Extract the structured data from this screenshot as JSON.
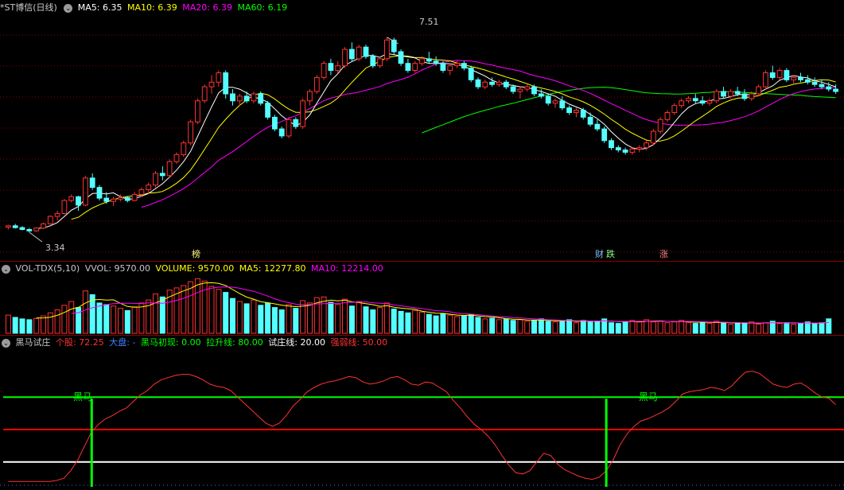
{
  "kline_legend": {
    "title": "*ST博信(日线)",
    "ma5": "MA5: 6.35",
    "ma10": "MA10: 6.39",
    "ma20": "MA20: 6.39",
    "ma60": "MA60: 6.19"
  },
  "kline_marks": {
    "high": "7.51",
    "low": "3.34",
    "bang": "榜",
    "cai": "财",
    "die": "跌",
    "zhang": "涨"
  },
  "vol_legend": {
    "name": "VOL-TDX(5,10)",
    "vvol": "VVOL: 9570.00",
    "volume": "VOLUME: 9570.00",
    "ma5": "MA5: 12277.80",
    "ma10": "MA10: 12214.00"
  },
  "ind_legend": {
    "name": "黑马试庄",
    "gegu": "个股: 72.25",
    "dapan": "大盘: -",
    "heima": "黑马初现: 0.00",
    "lasheng": "拉升线: 80.00",
    "shizhuang": "试庄线: 20.00",
    "qiangruo": "强弱线: 50.00"
  },
  "ind_annotations": [
    "黑马",
    "黑马"
  ],
  "colors": {
    "up": "#ff3232",
    "down": "#54ffff",
    "ma5": "#ffffff",
    "ma10": "#ffff00",
    "ma20": "#ff00ff",
    "ma60": "#00ff00",
    "separator": "#8b0000",
    "lasheng_line": "#00ff00",
    "qiangruo_line": "#ff0000",
    "shizhuang_line": "#ffffff"
  },
  "chart_data": [
    {
      "type": "candlestick",
      "title": "*ST博信(日线)",
      "ylim": [
        3.0,
        8.0
      ],
      "candles": [
        [
          3.45,
          3.5,
          3.4,
          3.48
        ],
        [
          3.48,
          3.52,
          3.42,
          3.44
        ],
        [
          3.44,
          3.47,
          3.38,
          3.4
        ],
        [
          3.4,
          3.43,
          3.34,
          3.37
        ],
        [
          3.37,
          3.45,
          3.35,
          3.43
        ],
        [
          3.43,
          3.55,
          3.41,
          3.52
        ],
        [
          3.52,
          3.7,
          3.5,
          3.68
        ],
        [
          3.68,
          3.8,
          3.6,
          3.74
        ],
        [
          3.74,
          4.05,
          3.72,
          4.02
        ],
        [
          4.02,
          4.15,
          3.98,
          4.1
        ],
        [
          4.1,
          4.12,
          3.8,
          3.92
        ],
        [
          3.92,
          4.55,
          3.9,
          4.5
        ],
        [
          4.5,
          4.6,
          4.25,
          4.3
        ],
        [
          4.3,
          4.35,
          4.02,
          4.07
        ],
        [
          4.07,
          4.2,
          3.95,
          4.0
        ],
        [
          4.0,
          4.1,
          3.9,
          4.05
        ],
        [
          4.05,
          4.15,
          4.0,
          4.08
        ],
        [
          4.08,
          4.12,
          3.98,
          4.02
        ],
        [
          4.02,
          4.2,
          4.0,
          4.15
        ],
        [
          4.15,
          4.3,
          4.1,
          4.25
        ],
        [
          4.25,
          4.4,
          4.15,
          4.35
        ],
        [
          4.35,
          4.65,
          4.3,
          4.6
        ],
        [
          4.6,
          4.75,
          4.45,
          4.55
        ],
        [
          4.55,
          4.9,
          4.5,
          4.85
        ],
        [
          4.85,
          5.05,
          4.8,
          5.0
        ],
        [
          5.0,
          5.3,
          4.95,
          5.25
        ],
        [
          5.25,
          5.75,
          5.2,
          5.7
        ],
        [
          5.7,
          6.2,
          5.65,
          6.15
        ],
        [
          6.15,
          6.5,
          6.1,
          6.45
        ],
        [
          6.45,
          6.7,
          6.3,
          6.55
        ],
        [
          6.55,
          6.8,
          6.45,
          6.75
        ],
        [
          6.75,
          6.8,
          6.2,
          6.3
        ],
        [
          6.3,
          6.4,
          6.05,
          6.15
        ],
        [
          6.15,
          6.3,
          6.05,
          6.25
        ],
        [
          6.25,
          6.35,
          6.1,
          6.15
        ],
        [
          6.15,
          6.35,
          6.1,
          6.3
        ],
        [
          6.3,
          6.35,
          6.05,
          6.1
        ],
        [
          6.1,
          6.15,
          5.75,
          5.8
        ],
        [
          5.8,
          5.85,
          5.5,
          5.55
        ],
        [
          5.55,
          5.6,
          5.35,
          5.4
        ],
        [
          5.4,
          5.8,
          5.35,
          5.75
        ],
        [
          5.75,
          5.8,
          5.55,
          5.6
        ],
        [
          5.6,
          6.2,
          5.55,
          6.15
        ],
        [
          6.15,
          6.4,
          6.05,
          6.35
        ],
        [
          6.35,
          6.7,
          6.3,
          6.65
        ],
        [
          6.65,
          7.0,
          6.6,
          6.95
        ],
        [
          6.95,
          7.05,
          6.7,
          6.8
        ],
        [
          6.8,
          7.0,
          6.75,
          6.9
        ],
        [
          6.9,
          7.3,
          6.85,
          7.25
        ],
        [
          7.25,
          7.4,
          7.0,
          7.05
        ],
        [
          7.05,
          7.35,
          7.0,
          7.3
        ],
        [
          7.3,
          7.35,
          7.05,
          7.1
        ],
        [
          7.1,
          7.15,
          6.85,
          6.9
        ],
        [
          6.9,
          7.1,
          6.85,
          7.05
        ],
        [
          7.05,
          7.51,
          7.0,
          7.45
        ],
        [
          7.45,
          7.5,
          7.15,
          7.2
        ],
        [
          7.2,
          7.25,
          6.9,
          6.95
        ],
        [
          6.95,
          7.05,
          6.75,
          6.8
        ],
        [
          6.8,
          7.0,
          6.75,
          6.95
        ],
        [
          6.95,
          7.1,
          6.9,
          7.05
        ],
        [
          7.05,
          7.2,
          6.95,
          7.0
        ],
        [
          7.0,
          7.1,
          6.9,
          6.95
        ],
        [
          6.95,
          7.0,
          6.75,
          6.8
        ],
        [
          6.8,
          6.95,
          6.7,
          6.9
        ],
        [
          6.9,
          7.0,
          6.85,
          6.95
        ],
        [
          6.95,
          7.0,
          6.8,
          6.85
        ],
        [
          6.85,
          6.9,
          6.55,
          6.6
        ],
        [
          6.6,
          6.65,
          6.4,
          6.45
        ],
        [
          6.45,
          6.6,
          6.4,
          6.55
        ],
        [
          6.55,
          6.65,
          6.45,
          6.5
        ],
        [
          6.5,
          6.6,
          6.45,
          6.55
        ],
        [
          6.55,
          6.6,
          6.4,
          6.45
        ],
        [
          6.45,
          6.5,
          6.3,
          6.35
        ],
        [
          6.35,
          6.45,
          6.2,
          6.4
        ],
        [
          6.4,
          6.5,
          6.35,
          6.45
        ],
        [
          6.45,
          6.5,
          6.25,
          6.3
        ],
        [
          6.3,
          6.4,
          6.2,
          6.25
        ],
        [
          6.25,
          6.3,
          6.05,
          6.1
        ],
        [
          6.1,
          6.2,
          6.0,
          6.15
        ],
        [
          6.15,
          6.25,
          5.95,
          6.0
        ],
        [
          6.0,
          6.05,
          5.85,
          5.9
        ],
        [
          5.9,
          6.0,
          5.8,
          5.95
        ],
        [
          5.95,
          6.0,
          5.75,
          5.8
        ],
        [
          5.8,
          5.9,
          5.6,
          5.65
        ],
        [
          5.65,
          5.75,
          5.5,
          5.55
        ],
        [
          5.55,
          5.6,
          5.25,
          5.3
        ],
        [
          5.3,
          5.35,
          5.1,
          5.15
        ],
        [
          5.15,
          5.2,
          5.05,
          5.1
        ],
        [
          5.1,
          5.15,
          5.0,
          5.05
        ],
        [
          5.05,
          5.15,
          5.0,
          5.12
        ],
        [
          5.12,
          5.2,
          5.05,
          5.15
        ],
        [
          5.15,
          5.3,
          5.1,
          5.25
        ],
        [
          5.25,
          5.55,
          5.2,
          5.5
        ],
        [
          5.5,
          5.8,
          5.45,
          5.75
        ],
        [
          5.75,
          5.95,
          5.7,
          5.9
        ],
        [
          5.9,
          6.1,
          5.85,
          6.05
        ],
        [
          6.05,
          6.2,
          6.0,
          6.15
        ],
        [
          6.15,
          6.25,
          6.1,
          6.2
        ],
        [
          6.2,
          6.3,
          6.1,
          6.15
        ],
        [
          6.15,
          6.25,
          6.05,
          6.1
        ],
        [
          6.1,
          6.2,
          6.05,
          6.15
        ],
        [
          6.15,
          6.4,
          6.1,
          6.35
        ],
        [
          6.35,
          6.45,
          6.2,
          6.25
        ],
        [
          6.25,
          6.4,
          6.2,
          6.35
        ],
        [
          6.35,
          6.45,
          6.25,
          6.3
        ],
        [
          6.3,
          6.4,
          6.15,
          6.2
        ],
        [
          6.2,
          6.35,
          6.15,
          6.3
        ],
        [
          6.3,
          6.5,
          6.25,
          6.45
        ],
        [
          6.45,
          6.8,
          6.4,
          6.75
        ],
        [
          6.75,
          6.9,
          6.6,
          6.65
        ],
        [
          6.65,
          6.85,
          6.6,
          6.8
        ],
        [
          6.8,
          6.85,
          6.55,
          6.6
        ],
        [
          6.6,
          6.7,
          6.5,
          6.65
        ],
        [
          6.65,
          6.75,
          6.55,
          6.6
        ],
        [
          6.6,
          6.7,
          6.5,
          6.55
        ],
        [
          6.55,
          6.65,
          6.45,
          6.5
        ],
        [
          6.5,
          6.6,
          6.4,
          6.45
        ],
        [
          6.45,
          6.55,
          6.35,
          6.4
        ],
        [
          6.4,
          6.5,
          6.3,
          6.35
        ]
      ],
      "ma_levels": {
        "MA5": 6.35,
        "MA10": 6.39,
        "MA20": 6.39,
        "MA60": 6.19
      },
      "price_marks": {
        "high": 7.51,
        "low": 3.34
      }
    },
    {
      "type": "bar",
      "title": "VOL-TDX(5,10)",
      "values": [
        12000,
        10500,
        9500,
        9000,
        9800,
        11500,
        13500,
        15500,
        18500,
        21000,
        17000,
        28000,
        25500,
        20000,
        19000,
        18000,
        16500,
        15000,
        17500,
        20000,
        22000,
        26000,
        24000,
        28500,
        30000,
        31500,
        34000,
        36000,
        34500,
        31000,
        29000,
        27000,
        23000,
        21000,
        19500,
        22000,
        18500,
        20000,
        17000,
        15500,
        19000,
        16500,
        21500,
        20000,
        23500,
        24000,
        20500,
        19000,
        22500,
        18000,
        21000,
        17500,
        15500,
        17000,
        20000,
        16000,
        14500,
        13500,
        15000,
        14000,
        12500,
        11500,
        13000,
        12000,
        11000,
        11500,
        12500,
        10500,
        9500,
        10000,
        9000,
        9500,
        8500,
        9000,
        8000,
        8500,
        9500,
        8000,
        7500,
        8000,
        9000,
        7000,
        8500,
        7500,
        8000,
        9500,
        7000,
        6500,
        7500,
        8500,
        8000,
        9000,
        7500,
        8000,
        7000,
        7500,
        8500,
        7000,
        6500,
        7500,
        6500,
        8000,
        7000,
        6000,
        7000,
        6500,
        7500,
        6000,
        7000,
        8000,
        6500,
        7000,
        6000,
        6500,
        7500,
        6500,
        7000,
        9570
      ],
      "series": [
        {
          "name": "MA5",
          "value": 12277.8
        },
        {
          "name": "MA10",
          "value": 12214.0
        }
      ]
    },
    {
      "type": "line",
      "title": "黑马试庄",
      "ylim": [
        0,
        100
      ],
      "values": [
        2,
        2,
        2,
        2,
        2,
        2,
        2,
        3,
        5,
        12,
        22,
        35,
        48,
        55,
        60,
        63,
        67,
        70,
        76,
        82,
        86,
        92,
        96,
        98,
        100,
        101,
        101,
        99,
        96,
        92,
        90,
        89,
        86,
        80,
        74,
        68,
        62,
        56,
        53,
        56,
        63,
        72,
        78,
        85,
        89,
        92,
        94,
        95,
        97,
        99,
        98,
        94,
        92,
        93,
        95,
        98,
        99,
        96,
        92,
        91,
        94,
        93,
        89,
        85,
        77,
        70,
        62,
        55,
        50,
        44,
        36,
        26,
        17,
        10,
        9,
        12,
        20,
        28,
        26,
        18,
        13,
        10,
        7,
        5,
        4,
        6,
        12,
        22,
        36,
        46,
        53,
        58,
        60,
        63,
        66,
        70,
        76,
        83,
        85,
        86,
        87,
        89,
        88,
        86,
        90,
        97,
        103,
        104,
        102,
        97,
        92,
        90,
        89,
        92,
        93,
        89,
        84,
        80,
        79,
        73
      ],
      "levels": [
        {
          "name": "拉升线",
          "value": 80
        },
        {
          "name": "强弱线",
          "value": 50
        },
        {
          "name": "试庄线",
          "value": 20
        }
      ],
      "signals": [
        {
          "label": "黑马",
          "index": 12
        },
        {
          "label": "黑马",
          "index": 86
        }
      ]
    }
  ]
}
